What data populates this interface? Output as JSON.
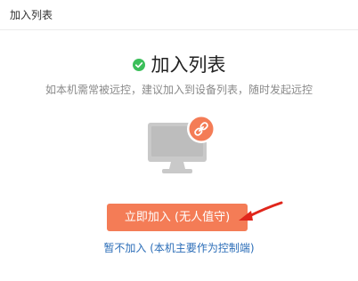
{
  "window": {
    "title": "加入列表"
  },
  "dialog": {
    "heading": "加入列表",
    "heading_icon": "check-circle-icon",
    "subtitle": "如本机需常被远控，建议加入到设备列表，随时发起远控",
    "illustration_icon": "monitor-icon",
    "badge_icon": "link-icon",
    "primary_button": "立即加入 (无人值守)",
    "secondary_link": "暂不加入 (本机主要作为控制端)",
    "annotation_icon": "red-arrow-icon"
  },
  "colors": {
    "accent_orange": "#f47c56",
    "check_green": "#3cbf5a",
    "link_blue": "#2c6eb8",
    "monitor_gray": "#c9c9c9",
    "annotation_red": "#e0261b"
  }
}
